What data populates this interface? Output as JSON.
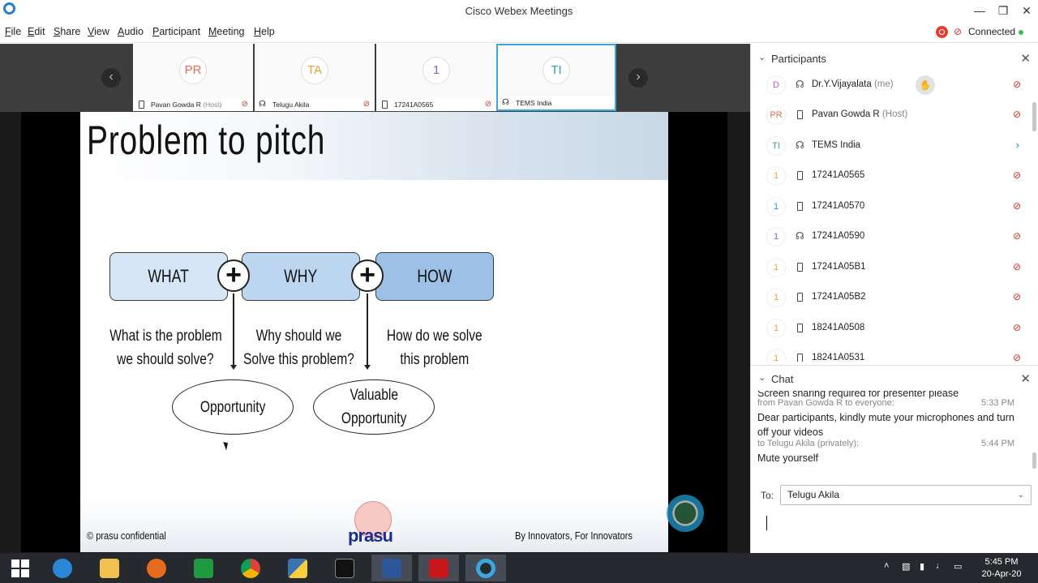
{
  "window": {
    "title": "Cisco Webex Meetings"
  },
  "menu": [
    {
      "label": "File",
      "u": "F",
      "rest": "ile"
    },
    {
      "label": "Edit",
      "u": "E",
      "rest": "dit"
    },
    {
      "label": "Share",
      "u": "S",
      "rest": "hare"
    },
    {
      "label": "View",
      "u": "V",
      "rest": "iew"
    },
    {
      "label": "Audio",
      "u": "A",
      "rest": "udio"
    },
    {
      "label": "Participant",
      "u": "P",
      "rest": "articipant"
    },
    {
      "label": "Meeting",
      "u": "M",
      "rest": "eeting"
    },
    {
      "label": "Help",
      "u": "H",
      "rest": "elp"
    }
  ],
  "status": {
    "connection": "Connected",
    "connection_color": "#3bbf4a",
    "record_color": "#e23e30"
  },
  "thumbnails": [
    {
      "initials": "PR",
      "name": "Pavan Gowda R",
      "role": "(Host)",
      "color": "#e26b5d"
    },
    {
      "initials": "TA",
      "name": "Telugu Akila",
      "role": "",
      "color": "#e4a23a"
    },
    {
      "initials": "1",
      "name": "17241A0565",
      "role": "",
      "color": "#8a5fc7"
    },
    {
      "initials": "TI",
      "name": "TEMS India",
      "role": "",
      "color": "#2aa79b"
    }
  ],
  "slide": {
    "title": "Problem to pitch",
    "boxes": [
      "WHAT",
      "WHY",
      "HOW"
    ],
    "plus": "+",
    "questions": [
      [
        "What is the problem",
        "we should solve?"
      ],
      [
        "Why should we",
        "Solve this problem?"
      ],
      [
        "How do we solve",
        "this problem"
      ]
    ],
    "outcomes": [
      [
        "Opportunity"
      ],
      [
        "Valuable",
        "Opportunity"
      ]
    ],
    "footer_left": "© prasu confidential",
    "footer_right": "By Innovators, For Innovators",
    "logo_text": "prasu"
  },
  "participants_panel": {
    "title": "Participants",
    "rows": [
      {
        "initials": "D",
        "name": "Dr.Y.Vijayalata",
        "role": "(me)",
        "device": "headset",
        "color": "#b05bd1",
        "hand": true,
        "mute": true
      },
      {
        "initials": "PR",
        "name": "Pavan Gowda R",
        "role": "(Host)",
        "device": "phone",
        "color": "#e26b5d",
        "mute": true
      },
      {
        "initials": "TI",
        "name": "TEMS India",
        "role": "",
        "device": "headset",
        "color": "#2aa79b",
        "arrow": true
      },
      {
        "initials": "1",
        "name": "17241A0565",
        "role": "",
        "device": "phone",
        "color": "#e4a23a",
        "mute": true
      },
      {
        "initials": "1",
        "name": "17241A0570",
        "role": "",
        "device": "phone",
        "color": "#3a8fd6",
        "mute": true
      },
      {
        "initials": "1",
        "name": "17241A0590",
        "role": "",
        "device": "headset",
        "color": "#8a5fc7",
        "mute": true
      },
      {
        "initials": "1",
        "name": "17241A05B1",
        "role": "",
        "device": "phone",
        "color": "#e4a23a",
        "mute": true
      },
      {
        "initials": "1",
        "name": "17241A05B2",
        "role": "",
        "device": "phone",
        "color": "#e4a23a",
        "mute": true
      },
      {
        "initials": "1",
        "name": "18241A0508",
        "role": "",
        "device": "phone",
        "color": "#e4a23a",
        "mute": true
      },
      {
        "initials": "1",
        "name": "18241A0531",
        "role": "",
        "device": "phone",
        "color": "#e4a23a",
        "mute": true
      }
    ]
  },
  "chat_panel": {
    "title": "Chat",
    "messages": [
      {
        "meta": "",
        "time": "",
        "text": "Screen sharing required for presenter please"
      },
      {
        "meta": "from Pavan Gowda R to everyone:",
        "time": "5:33 PM",
        "text": "Dear participants, kindly mute your microphones and turn off your videos"
      },
      {
        "meta": "to Telugu Akila (privately):",
        "time": "5:44 PM",
        "text": "Mute yourself"
      }
    ],
    "to_label": "To:",
    "to_value": "Telugu Akila"
  },
  "taskbar": {
    "clock_time": "5:45 PM",
    "clock_date": "20-Apr-20"
  }
}
